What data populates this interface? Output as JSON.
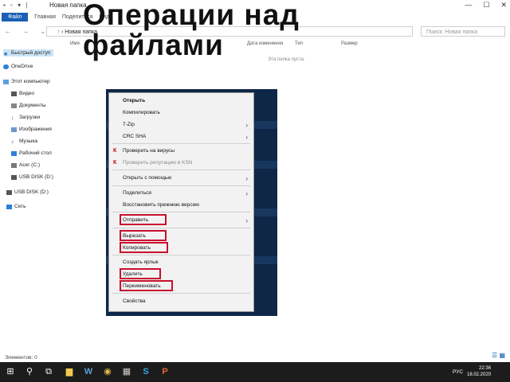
{
  "window": {
    "title": "Новая папка",
    "controls": {
      "minimize": "—",
      "maximize": "☐",
      "close": "✕"
    }
  },
  "ribbon": {
    "file_tab": "Файл",
    "tabs": [
      "Главная",
      "Поделиться",
      "Вид"
    ]
  },
  "address_bar": {
    "path": "› Новая папка",
    "search_placeholder": "Поиск: Новая папка"
  },
  "columns": [
    "Имя",
    "Дата изменения",
    "Тип",
    "Размер"
  ],
  "empty_message": "Эта папка пуста.",
  "sidebar": {
    "items": [
      {
        "label": "Быстрый доступ",
        "icon": "star-icon"
      },
      {
        "label": "OneDrive",
        "icon": "cloud-icon"
      },
      {
        "label": "Этот компьютер",
        "icon": "computer-icon"
      },
      {
        "label": "Видео",
        "icon": "video-icon"
      },
      {
        "label": "Документы",
        "icon": "document-icon"
      },
      {
        "label": "Загрузки",
        "icon": "download-icon"
      },
      {
        "label": "Изображения",
        "icon": "image-icon"
      },
      {
        "label": "Музыка",
        "icon": "music-icon"
      },
      {
        "label": "Рабочий стол",
        "icon": "desktop-icon"
      },
      {
        "label": "Acer (C:)",
        "icon": "drive-icon"
      },
      {
        "label": "USB DISK (D:)",
        "icon": "usb-icon"
      },
      {
        "label": "USB DISK (D:)",
        "icon": "usb-icon"
      },
      {
        "label": "Сеть",
        "icon": "network-icon"
      }
    ]
  },
  "status_bar": {
    "text": "Элементов: 0"
  },
  "slide_title": {
    "line1": "Операции над",
    "line2": "файлами"
  },
  "context_menu": {
    "items": [
      {
        "label": "Открыть",
        "style": "bold"
      },
      {
        "label": "Компилировать"
      },
      {
        "label": "7-Zip",
        "submenu": true
      },
      {
        "label": "CRC SHA",
        "submenu": true
      },
      {
        "label": "Проверить на вирусы",
        "kaspersky": true
      },
      {
        "label": "Проверить репутацию в KSN",
        "kaspersky": true,
        "style": "gray"
      },
      {
        "label": "Открыть с помощью",
        "submenu": true
      },
      {
        "label": "Поделиться",
        "submenu": true
      },
      {
        "label": "Восстановить прежнюю версию"
      },
      {
        "label": "Отправить",
        "submenu": true,
        "highlighted": true
      },
      {
        "label": "Вырезать",
        "highlighted": true
      },
      {
        "label": "Копировать",
        "highlighted": true
      },
      {
        "label": "Создать ярлык"
      },
      {
        "label": "Удалить",
        "highlighted": true
      },
      {
        "label": "Переименовать",
        "highlighted": true
      },
      {
        "label": "Свойства"
      }
    ],
    "highlight_color": "#c8102e",
    "submenu_arrow": "›",
    "kaspersky_icon": "К"
  },
  "taskbar": {
    "buttons": [
      {
        "icon": "windows-start-icon",
        "glyph": "⊞"
      },
      {
        "icon": "search-icon",
        "glyph": "⚲"
      },
      {
        "icon": "task-view-icon",
        "glyph": "⧉"
      },
      {
        "icon": "explorer-icon",
        "glyph": "▆"
      },
      {
        "icon": "word-icon",
        "glyph": "W"
      },
      {
        "icon": "chrome-icon",
        "glyph": "◉"
      },
      {
        "icon": "app-icon",
        "glyph": "▦"
      },
      {
        "icon": "skype-icon",
        "glyph": "S"
      },
      {
        "icon": "powerpoint-icon",
        "glyph": "P"
      }
    ],
    "language": "РУС",
    "time": "22:36",
    "date": "18.02.2020"
  },
  "colors": {
    "accent": "#1a5fb4",
    "picture_background": "#0e2747",
    "taskbar": "#1c1c1c"
  }
}
